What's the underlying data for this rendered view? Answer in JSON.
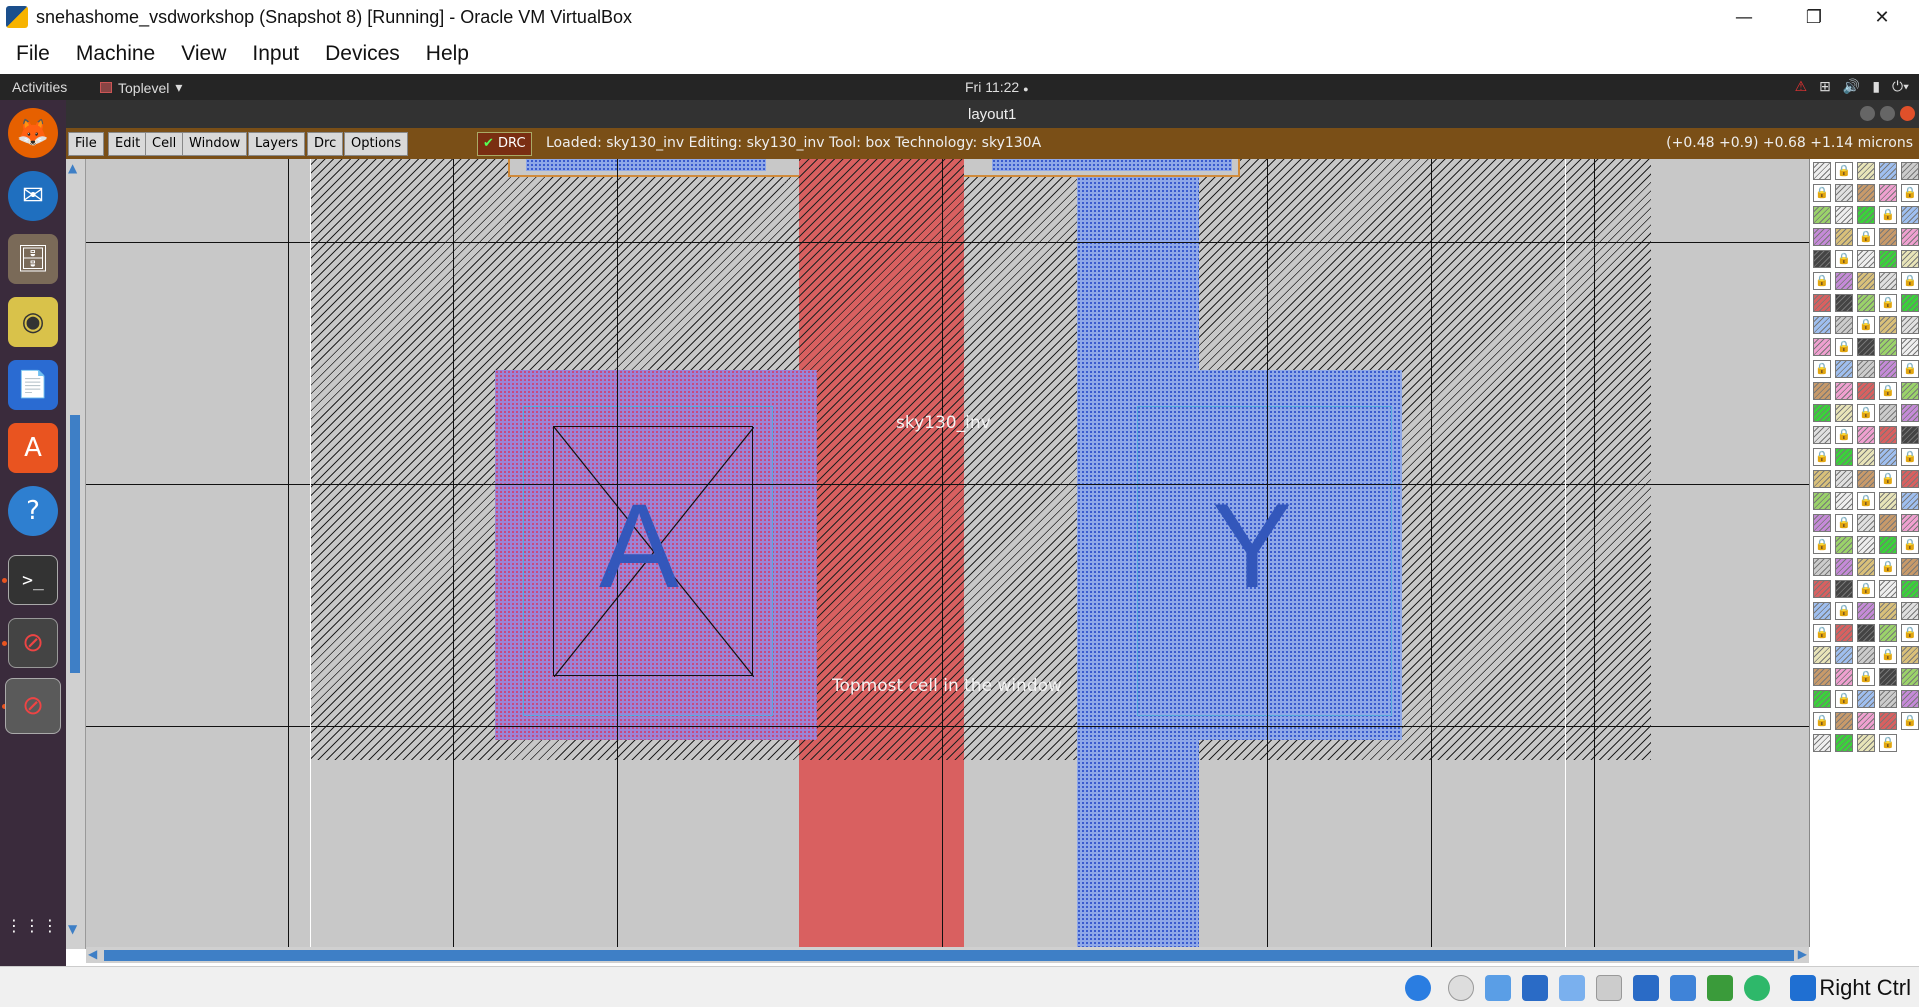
{
  "window": {
    "title": "snehashome_vsdworkshop (Snapshot 8) [Running] - Oracle VM VirtualBox",
    "minimize": "—",
    "restore": "❐",
    "close": "✕"
  },
  "host_menu": [
    "File",
    "Machine",
    "View",
    "Input",
    "Devices",
    "Help"
  ],
  "guest_topbar": {
    "activities": "Activities",
    "app_name": "Toplevel",
    "app_caret": "▾",
    "clock": "Fri 11:22",
    "clock_dot": "●",
    "tray_icons": [
      "warning-icon",
      "network-icon",
      "volume-icon",
      "battery-icon",
      "power-menu-icon"
    ],
    "tray_glyphs": [
      "⚠",
      "⊞",
      "🔊",
      "▮",
      "⏻▾"
    ]
  },
  "dock": [
    {
      "name": "firefox-icon",
      "glyph": "🦊",
      "color": "#e66000"
    },
    {
      "name": "thunderbird-icon",
      "glyph": "✉",
      "color": "#1f6fbf"
    },
    {
      "name": "files-icon",
      "glyph": "🗄",
      "color": "#7a6a58"
    },
    {
      "name": "rhythmbox-icon",
      "glyph": "◉",
      "color": "#d9c24a"
    },
    {
      "name": "writer-icon",
      "glyph": "📄",
      "color": "#2a6bd2"
    },
    {
      "name": "software-icon",
      "glyph": "A",
      "color": "#e95420"
    },
    {
      "name": "help-icon",
      "glyph": "?",
      "color": "#2e7fd0"
    },
    {
      "name": "terminal-icon",
      "glyph": ">_",
      "color": "#333333"
    },
    {
      "name": "app-blocked-icon",
      "glyph": "⊘",
      "color": "#444444"
    },
    {
      "name": "app-blocked-active-icon",
      "glyph": "⊘",
      "color": "#555555"
    },
    {
      "name": "show-apps-icon",
      "glyph": "⋮⋮⋮",
      "color": "transparent"
    }
  ],
  "magic": {
    "window_title": "layout1",
    "menus": [
      "File",
      "Edit",
      "Cell",
      "Window",
      "Layers",
      "Drc",
      "Options"
    ],
    "drc_label": "DRC",
    "drc_check": "✔",
    "status": "Loaded: sky130_inv Editing: sky130_inv Tool: box  Technology: sky130A",
    "coords": "(+0.48 +0.9) +0.68 +1.14 microns",
    "cell_label": "sky130_inv",
    "topmost_label": "Topmost cell in the window",
    "port_a": "A",
    "port_y": "Y"
  },
  "colors": {
    "poly": "#d96060",
    "metal": "#8fa8e8",
    "locali": "#9b85d6",
    "toolbar": "#7a4f17",
    "scroll_thumb": "#3e7fc6"
  },
  "statusbar": {
    "host_key": "Right Ctrl",
    "icons": [
      "hdd-icon",
      "optical-icon",
      "audio-icon",
      "network-icon",
      "usb-icon",
      "shared-folder-icon",
      "display-icon",
      "recording-icon",
      "cpu-icon",
      "mouse-integration-icon",
      "keyboard-icon"
    ]
  }
}
